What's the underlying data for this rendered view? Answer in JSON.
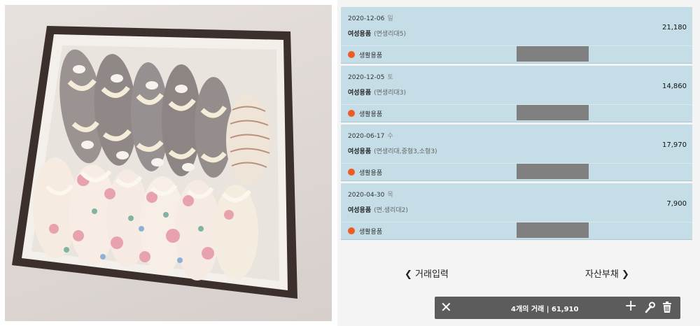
{
  "transactions": [
    {
      "date": "2020-12-06",
      "weekday": "일",
      "category": "여성용품",
      "memo": "(면생리대5)",
      "amount": "21,180",
      "account": "생활용품"
    },
    {
      "date": "2020-12-05",
      "weekday": "토",
      "category": "여성용품",
      "memo": "(면생리대3)",
      "amount": "14,860",
      "account": "생활용품"
    },
    {
      "date": "2020-06-17",
      "weekday": "수",
      "category": "여성용품",
      "memo": "(면생리대,중형3,소형3)",
      "amount": "17,970",
      "account": "생활용품"
    },
    {
      "date": "2020-04-30",
      "weekday": "목",
      "category": "여성용품",
      "memo": "(면.생리대2)",
      "amount": "7,900",
      "account": "생활용품"
    }
  ],
  "nav": {
    "prev_label": "거래입력",
    "next_label": "자산부채"
  },
  "bottom_bar": {
    "summary": "4개의 거래  | 61,910"
  },
  "icons": {
    "account_dot_color": "#f05a24",
    "prev": "chevron-left-icon",
    "next": "chevron-right-icon",
    "close": "close-icon",
    "add": "plus-icon",
    "edit": "wrench-icon",
    "delete": "trash-icon"
  }
}
